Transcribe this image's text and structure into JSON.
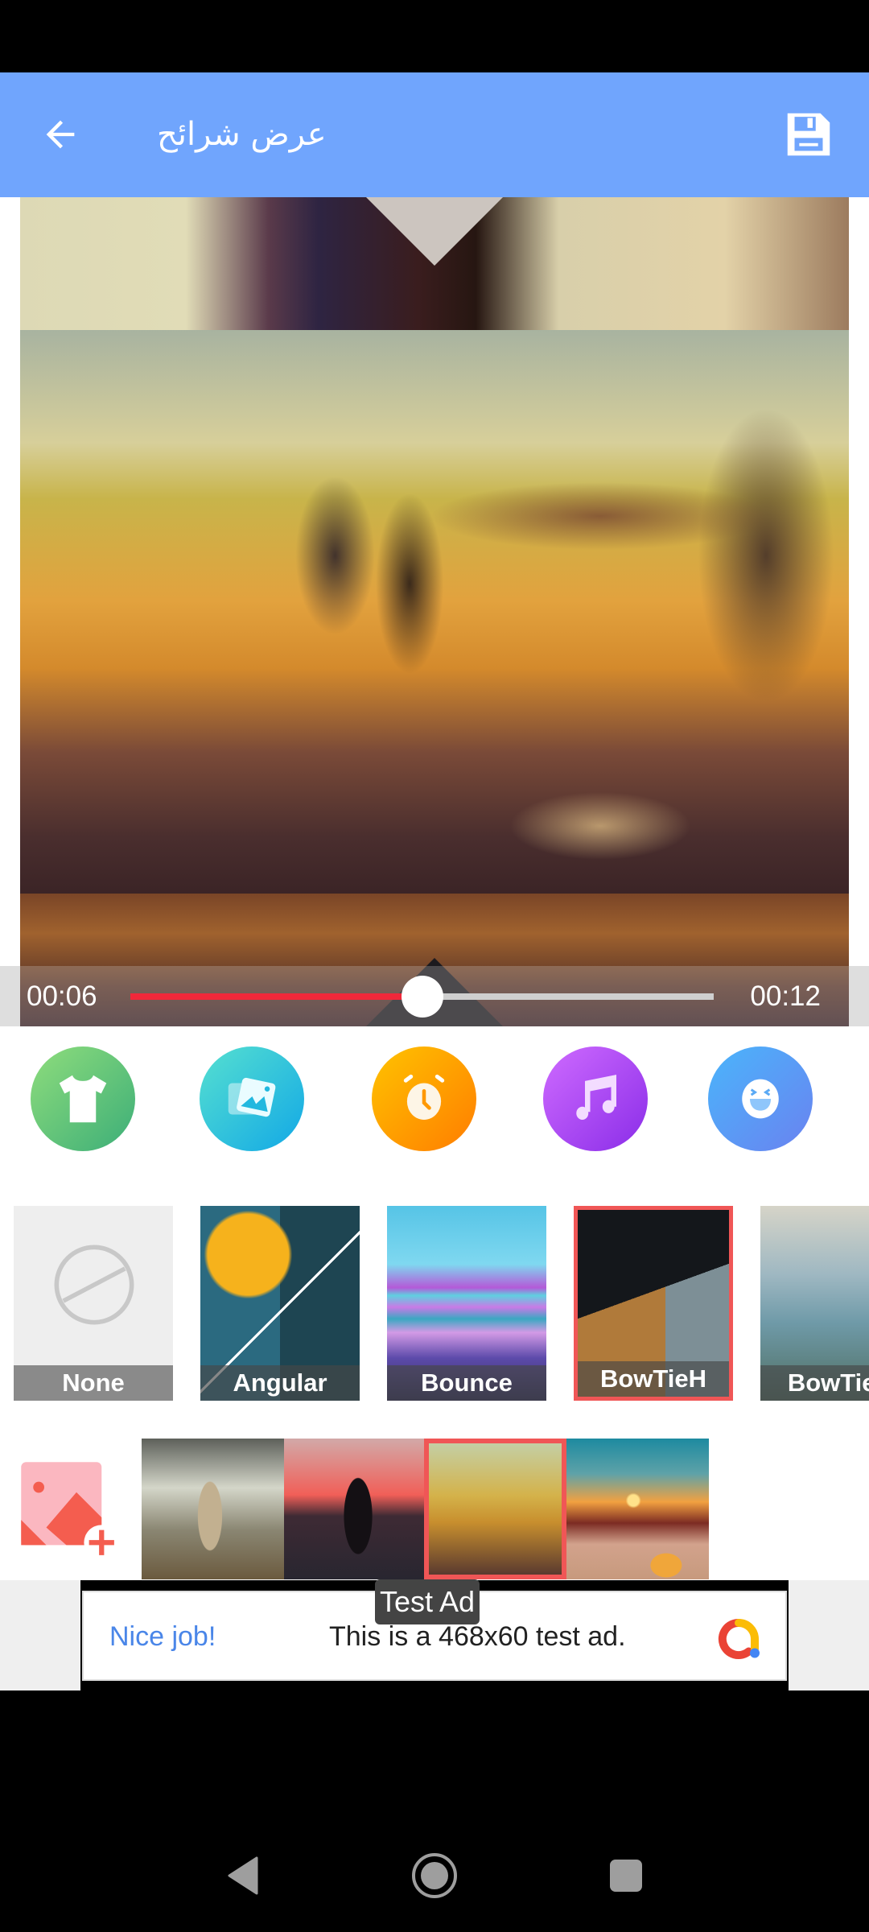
{
  "app_bar": {
    "title": "عرض شرائح",
    "back_icon": "arrow-left-icon",
    "save_icon": "floppy-disk-icon",
    "color": "#70a5fd"
  },
  "player": {
    "current_time": "00:06",
    "total_time": "00:12",
    "progress_fraction": 0.5,
    "progress_color": "#f0283a"
  },
  "tools": [
    {
      "name": "theme",
      "icon": "tshirt-icon",
      "colors": [
        "#8fdd7c",
        "#3cae78"
      ]
    },
    {
      "name": "background-image",
      "icon": "image-icon",
      "colors": [
        "#56e0d0",
        "#12a8e6"
      ]
    },
    {
      "name": "duration",
      "icon": "alarm-clock-icon",
      "colors": [
        "#ffc300",
        "#ff7d00"
      ]
    },
    {
      "name": "music",
      "icon": "music-note-icon",
      "colors": [
        "#cf6bff",
        "#8a2de8"
      ]
    },
    {
      "name": "sticker",
      "icon": "laughing-face-icon",
      "colors": [
        "#4ab5fb",
        "#6a82f0"
      ]
    }
  ],
  "transitions": [
    {
      "label": "None",
      "selected": false
    },
    {
      "label": "Angular",
      "selected": false
    },
    {
      "label": "Bounce",
      "selected": false
    },
    {
      "label": "BowTieH",
      "selected": true
    },
    {
      "label": "BowTieV",
      "selected": false
    }
  ],
  "photos": {
    "add_icon": "add-photo-icon",
    "items": [
      {
        "name": "man-on-railway",
        "selected": false
      },
      {
        "name": "man-on-boat-sunset",
        "selected": false
      },
      {
        "name": "hand-sand-beach",
        "selected": true
      },
      {
        "name": "beach-sunset-jar",
        "selected": false
      }
    ],
    "selected_color": "#f05656"
  },
  "ad": {
    "badge": "Test Ad",
    "headline": "Nice job!",
    "body": "This is a 468x60 test ad."
  },
  "nav": {
    "back": "nav-back-icon",
    "home": "nav-home-icon",
    "recents": "nav-recents-icon"
  }
}
